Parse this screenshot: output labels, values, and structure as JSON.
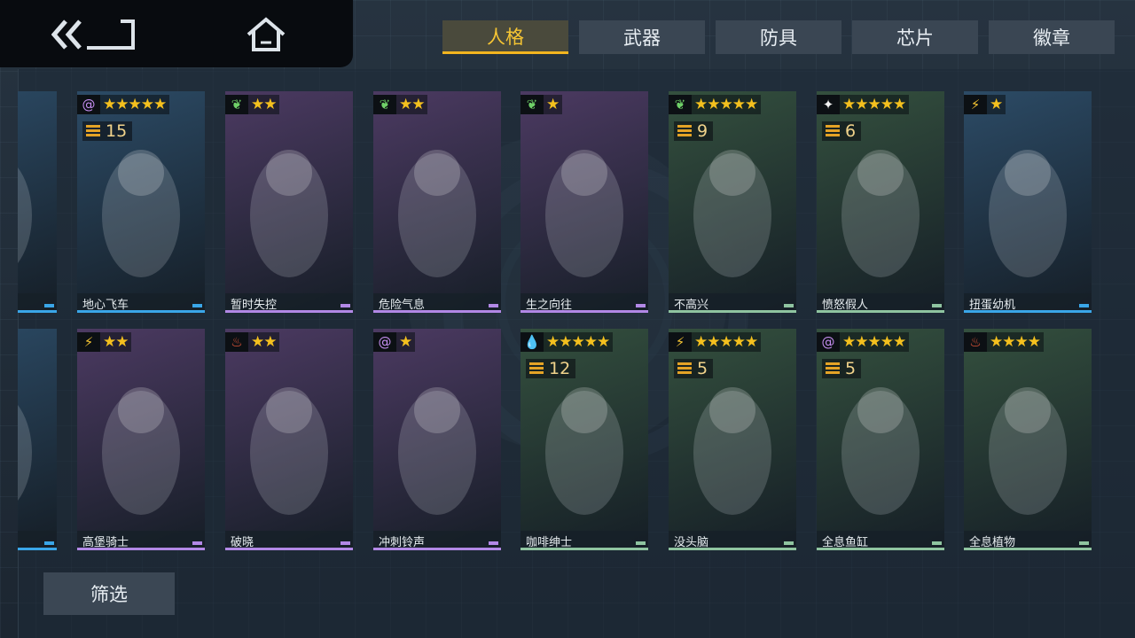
{
  "nav": {
    "back_icon": "double-chevron-back-icon",
    "home_icon": "home-icon"
  },
  "tabs": [
    {
      "label": "人格",
      "active": true
    },
    {
      "label": "武器",
      "active": false
    },
    {
      "label": "防具",
      "active": false
    },
    {
      "label": "芯片",
      "active": false
    },
    {
      "label": "徽章",
      "active": false
    }
  ],
  "colors": {
    "accent": "#f3b51f",
    "purple": "#b288e6",
    "blue": "#3aa6e8",
    "green": "#8fc4a0"
  },
  "cards": [
    {
      "name": "",
      "element": "lightning",
      "stars": "★",
      "level": "",
      "rarity": "blue",
      "bg": "#2c4b66"
    },
    {
      "name": "地心飞车",
      "element": "spiral",
      "stars": "★★★★★",
      "level": "15",
      "rarity": "blue",
      "bg": "#2c4b66"
    },
    {
      "name": "暂时失控",
      "element": "leaf",
      "stars": "★★",
      "level": "",
      "rarity": "purple",
      "bg": "#4c3a62"
    },
    {
      "name": "危险气息",
      "element": "leaf",
      "stars": "★★",
      "level": "",
      "rarity": "purple",
      "bg": "#4c3a62"
    },
    {
      "name": "生之向往",
      "element": "leaf",
      "stars": "★",
      "level": "",
      "rarity": "purple",
      "bg": "#4c3a62"
    },
    {
      "name": "不高兴",
      "element": "leaf",
      "stars": "★★★★★",
      "level": "9",
      "rarity": "green",
      "bg": "#34503e"
    },
    {
      "name": "愤怒假人",
      "element": "spark",
      "stars": "★★★★★",
      "level": "6",
      "rarity": "green",
      "bg": "#34503e"
    },
    {
      "name": "扭蛋幼机",
      "element": "lightning",
      "stars": "★",
      "level": "",
      "rarity": "blue",
      "bg": "#2c4b66"
    },
    {
      "name": "",
      "element": "lightning",
      "stars": "★",
      "level": "",
      "rarity": "blue",
      "bg": "#2c4b66"
    },
    {
      "name": "高堡骑士",
      "element": "lightning",
      "stars": "★★",
      "level": "",
      "rarity": "purple",
      "bg": "#4c3a62"
    },
    {
      "name": "破晓",
      "element": "fire",
      "stars": "★★",
      "level": "",
      "rarity": "purple",
      "bg": "#4c3a62"
    },
    {
      "name": "冲刺铃声",
      "element": "spiral",
      "stars": "★",
      "level": "",
      "rarity": "purple",
      "bg": "#4c3a62"
    },
    {
      "name": "咖啡绅士",
      "element": "water",
      "stars": "★★★★★",
      "level": "12",
      "rarity": "green",
      "bg": "#34503e"
    },
    {
      "name": "没头脑",
      "element": "lightning",
      "stars": "★★★★★",
      "level": "5",
      "rarity": "green",
      "bg": "#34503e"
    },
    {
      "name": "全息鱼缸",
      "element": "spiral",
      "stars": "★★★★★",
      "level": "5",
      "rarity": "green",
      "bg": "#34503e"
    },
    {
      "name": "全息植物",
      "element": "fire",
      "stars": "★★★★",
      "level": "",
      "rarity": "green",
      "bg": "#34503e"
    }
  ],
  "filter": {
    "label": "筛选"
  }
}
